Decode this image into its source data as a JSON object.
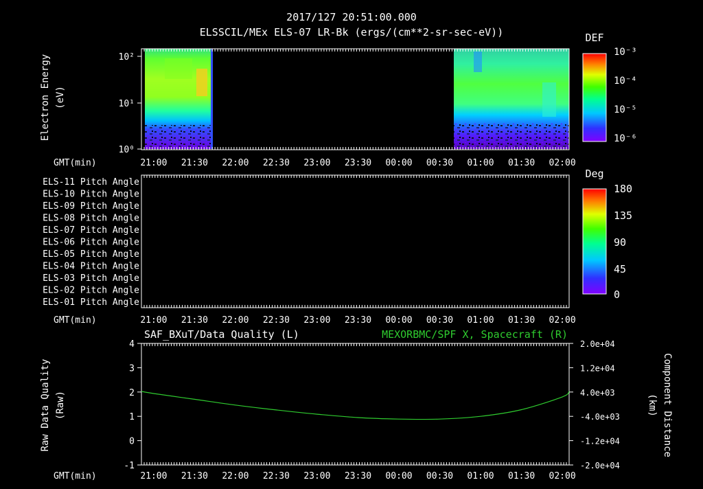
{
  "header": {
    "timestamp": "2017/127 20:51:00.000",
    "title": "ELSSCIL/MEx ELS-07 LR-Bk  (ergs/(cm**2-sr-sec-eV))"
  },
  "time_axis": {
    "label": "GMT(min)",
    "ticks": [
      "21:00",
      "21:30",
      "22:00",
      "22:30",
      "23:00",
      "23:30",
      "00:00",
      "00:30",
      "01:00",
      "01:30",
      "02:00"
    ]
  },
  "colors": {
    "background": "#000000",
    "foreground": "#ffffff",
    "line_left": "#000000",
    "line_right": "#2fcc2f",
    "right_title": "#2fcc2f"
  },
  "chart_data": [
    {
      "type": "heatmap",
      "ylabel": "Electron Energy",
      "yunits": "(eV)",
      "yscale": "log",
      "yticks": [
        "10²",
        "10¹",
        "10⁰"
      ],
      "ylim": [
        1,
        150
      ],
      "colorbar": {
        "label": "DEF",
        "ticks": [
          "10⁻³",
          "10⁻⁴",
          "10⁻⁵",
          "10⁻⁶"
        ],
        "scale": "log",
        "range": [
          1e-06,
          0.001
        ]
      },
      "data_intervals": [
        {
          "start": "20:51",
          "end": "21:42"
        },
        {
          "start": "00:48",
          "end": "02:05"
        }
      ],
      "no_data_interval": {
        "start": "21:42",
        "end": "00:48"
      },
      "dominant_band": {
        "energy_ev": [
          8,
          60
        ],
        "def": "1e-4 to 2e-4"
      },
      "low_energy_band": {
        "energy_ev": [
          1,
          4
        ],
        "def": "1e-6 to 3e-6"
      }
    },
    {
      "type": "heatmap",
      "ylabels": [
        "ELS-11 Pitch Angle",
        "ELS-10 Pitch Angle",
        "ELS-09 Pitch Angle",
        "ELS-08 Pitch Angle",
        "ELS-07 Pitch Angle",
        "ELS-06 Pitch Angle",
        "ELS-05 Pitch Angle",
        "ELS-04 Pitch Angle",
        "ELS-03 Pitch Angle",
        "ELS-02 Pitch Angle",
        "ELS-01 Pitch Angle"
      ],
      "colorbar": {
        "label": "Deg",
        "ticks": [
          "180",
          "135",
          "90",
          "45",
          "0"
        ],
        "range": [
          0,
          180
        ]
      },
      "data": []
    },
    {
      "type": "line",
      "title_left": "SAF_BXuT/Data Quality (L)",
      "title_right": "MEXORBMC/SPF X, Spacecraft (R)",
      "ylabel_left": "Raw Data Quality",
      "yunits_left": "(Raw)",
      "ylabel_right": "Component Distance",
      "yunits_right": "(km)",
      "yticks_left": [
        "4",
        "3",
        "2",
        "1",
        "0",
        "-1"
      ],
      "ylim_left": [
        -1,
        4
      ],
      "yticks_right": [
        "2.0e+04",
        "1.2e+04",
        "4.0e+03",
        "-4.0e+03",
        "-1.2e+04",
        "-2.0e+04"
      ],
      "ylim_right": [
        -20000,
        20000
      ],
      "series": [
        {
          "name": "MEXORBMC/SPF X, Spacecraft (R)",
          "axis": "right",
          "x": [
            "20:51",
            "21:00",
            "21:30",
            "22:00",
            "22:30",
            "23:00",
            "23:30",
            "00:00",
            "00:30",
            "01:00",
            "01:30",
            "02:00",
            "02:05"
          ],
          "y": [
            4200,
            3500,
            1600,
            -300,
            -1900,
            -3300,
            -4400,
            -4900,
            -4900,
            -4000,
            -1800,
            2400,
            4200
          ]
        }
      ]
    }
  ]
}
